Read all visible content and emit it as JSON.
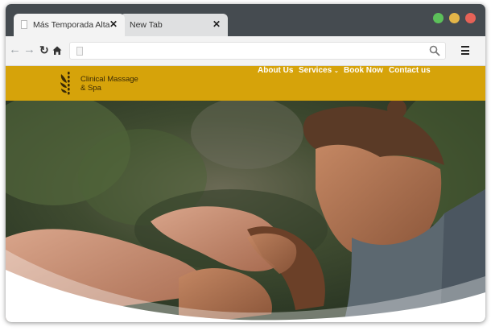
{
  "browser": {
    "tabs": [
      {
        "label": "Más Temporada Alta",
        "close": "✕"
      },
      {
        "label": "New Tab",
        "close": "✕"
      }
    ],
    "window_controls": [
      "green",
      "yellow",
      "red"
    ],
    "address": ""
  },
  "site": {
    "logo_line1": "Clinical Massage",
    "logo_line2": "& Spa",
    "nav": [
      {
        "label": "About Us"
      },
      {
        "label": "Services"
      },
      {
        "label": "Book Now"
      },
      {
        "label": "Contact us"
      }
    ],
    "brand_color": "#d6a30a"
  }
}
